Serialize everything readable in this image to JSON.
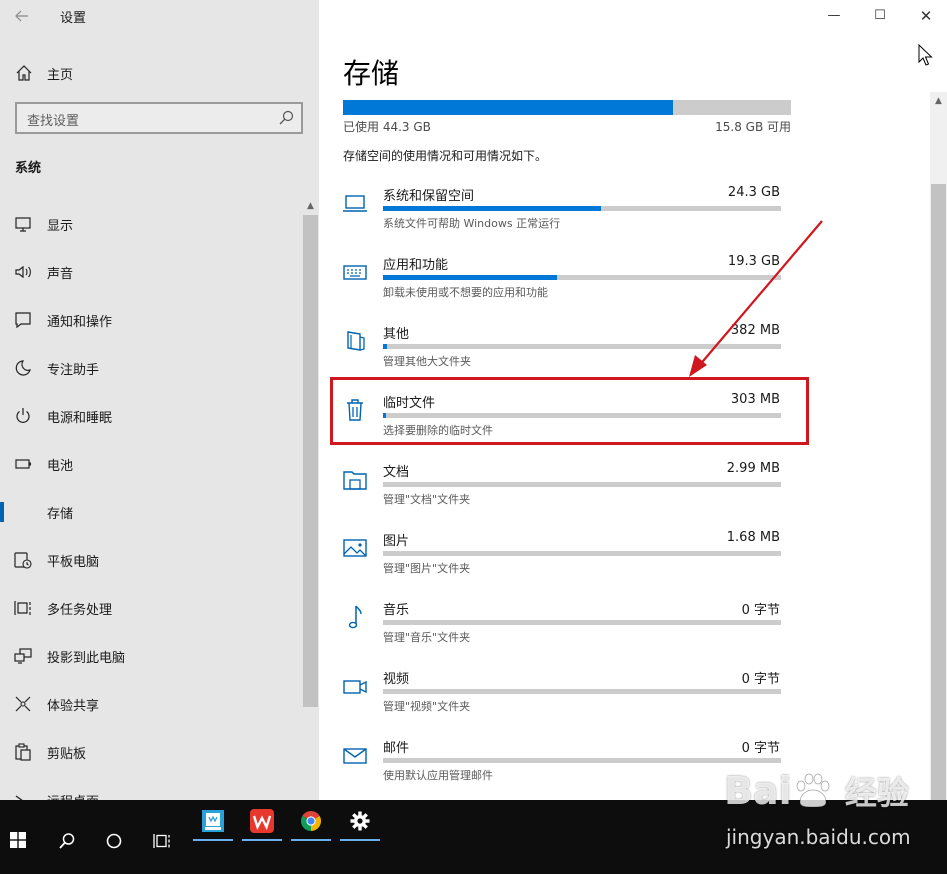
{
  "window": {
    "title": "设置",
    "back_icon": "arrow-left-icon",
    "controls": {
      "minimize": "—",
      "maximize": "☐",
      "close": "✕"
    }
  },
  "sidebar": {
    "home_label": "主页",
    "search_placeholder": "查找设置",
    "section_label": "系统",
    "active_item": "存储",
    "active_color": "#0063b1",
    "items": [
      {
        "label": "显示",
        "icon": "monitor-icon"
      },
      {
        "label": "声音",
        "icon": "speaker-icon"
      },
      {
        "label": "通知和操作",
        "icon": "message-icon"
      },
      {
        "label": "专注助手",
        "icon": "moon-icon"
      },
      {
        "label": "电源和睡眠",
        "icon": "power-icon"
      },
      {
        "label": "电池",
        "icon": "battery-icon"
      },
      {
        "label": "存储",
        "icon": "storage-icon"
      },
      {
        "label": "平板电脑",
        "icon": "tablet-icon"
      },
      {
        "label": "多任务处理",
        "icon": "multitask-icon"
      },
      {
        "label": "投影到此电脑",
        "icon": "project-icon"
      },
      {
        "label": "体验共享",
        "icon": "share-icon"
      },
      {
        "label": "剪贴板",
        "icon": "clipboard-icon"
      },
      {
        "label": "远程桌面",
        "icon": "remote-desktop-icon"
      }
    ]
  },
  "main": {
    "title": "存储",
    "used_label": "已使用 44.3 GB",
    "free_label": "15.8 GB 可用",
    "used_fraction": 0.737,
    "description": "存储空间的使用情况和可用情况如下。",
    "accent_color": "#0078d7",
    "categories": [
      {
        "name": "系统和保留空间",
        "size": "24.3 GB",
        "desc": "系统文件可帮助 Windows 正常运行",
        "fraction": 0.548,
        "icon": "laptop-icon"
      },
      {
        "name": "应用和功能",
        "size": "19.3 GB",
        "desc": "卸载未使用或不想要的应用和功能",
        "fraction": 0.436,
        "icon": "keyboard-icon"
      },
      {
        "name": "其他",
        "size": "382 MB",
        "desc": "管理其他大文件夹",
        "fraction": 0.009,
        "icon": "other-files-icon"
      },
      {
        "name": "临时文件",
        "size": "303 MB",
        "desc": "选择要删除的临时文件",
        "fraction": 0.007,
        "icon": "trash-icon"
      },
      {
        "name": "文档",
        "size": "2.99 MB",
        "desc": "管理\"文档\"文件夹",
        "fraction": 0,
        "icon": "folder-icon"
      },
      {
        "name": "图片",
        "size": "1.68 MB",
        "desc": "管理\"图片\"文件夹",
        "fraction": 0,
        "icon": "picture-icon"
      },
      {
        "name": "音乐",
        "size": "0 字节",
        "desc": "管理\"音乐\"文件夹",
        "fraction": 0,
        "icon": "music-note-icon"
      },
      {
        "name": "视频",
        "size": "0 字节",
        "desc": "管理\"视频\"文件夹",
        "fraction": 0,
        "icon": "video-camera-icon"
      },
      {
        "name": "邮件",
        "size": "0 字节",
        "desc": "使用默认应用管理邮件",
        "fraction": 0,
        "icon": "mail-icon"
      }
    ],
    "highlight_color": "#d0161e"
  },
  "taskbar": {
    "start_icon": "windows-start-icon",
    "search_icon": "search-icon",
    "cortana_icon": "cortana-circle-icon",
    "task_view_icon": "task-view-icon",
    "apps": [
      {
        "name": "notepad-app",
        "icon": "notepad-app-icon"
      },
      {
        "name": "wps-office",
        "icon": "wps-icon"
      },
      {
        "name": "chrome",
        "icon": "chrome-icon"
      },
      {
        "name": "settings",
        "icon": "gear-icon"
      }
    ]
  },
  "watermark": {
    "brand": "Bai 经验",
    "url": "jingyan.baidu.com"
  }
}
